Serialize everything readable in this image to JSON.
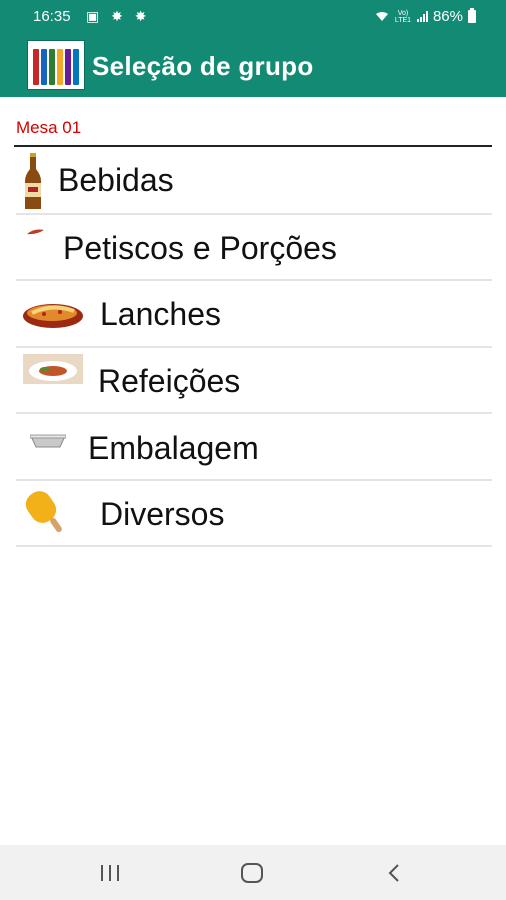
{
  "status_bar": {
    "time": "16:35",
    "left_icons": "▣ ✸ ✸",
    "volte": "Vo) LTE1",
    "battery": "86%"
  },
  "app_bar": {
    "title": "Seleção de grupo"
  },
  "table_label": "Mesa 01",
  "groups": [
    {
      "label": "Bebidas",
      "icon": "beer-bottle-icon"
    },
    {
      "label": "Petiscos e Porções",
      "icon": "chili-pepper-icon"
    },
    {
      "label": "Lanches",
      "icon": "sandwich-icon"
    },
    {
      "label": "Refeições",
      "icon": "meal-plate-icon"
    },
    {
      "label": "Embalagem",
      "icon": "container-icon"
    },
    {
      "label": "Diversos",
      "icon": "popsicle-icon"
    }
  ],
  "colors": {
    "app_bar": "#138a74",
    "table_label": "#d60000",
    "nav_bar": "#f1f1f1"
  }
}
